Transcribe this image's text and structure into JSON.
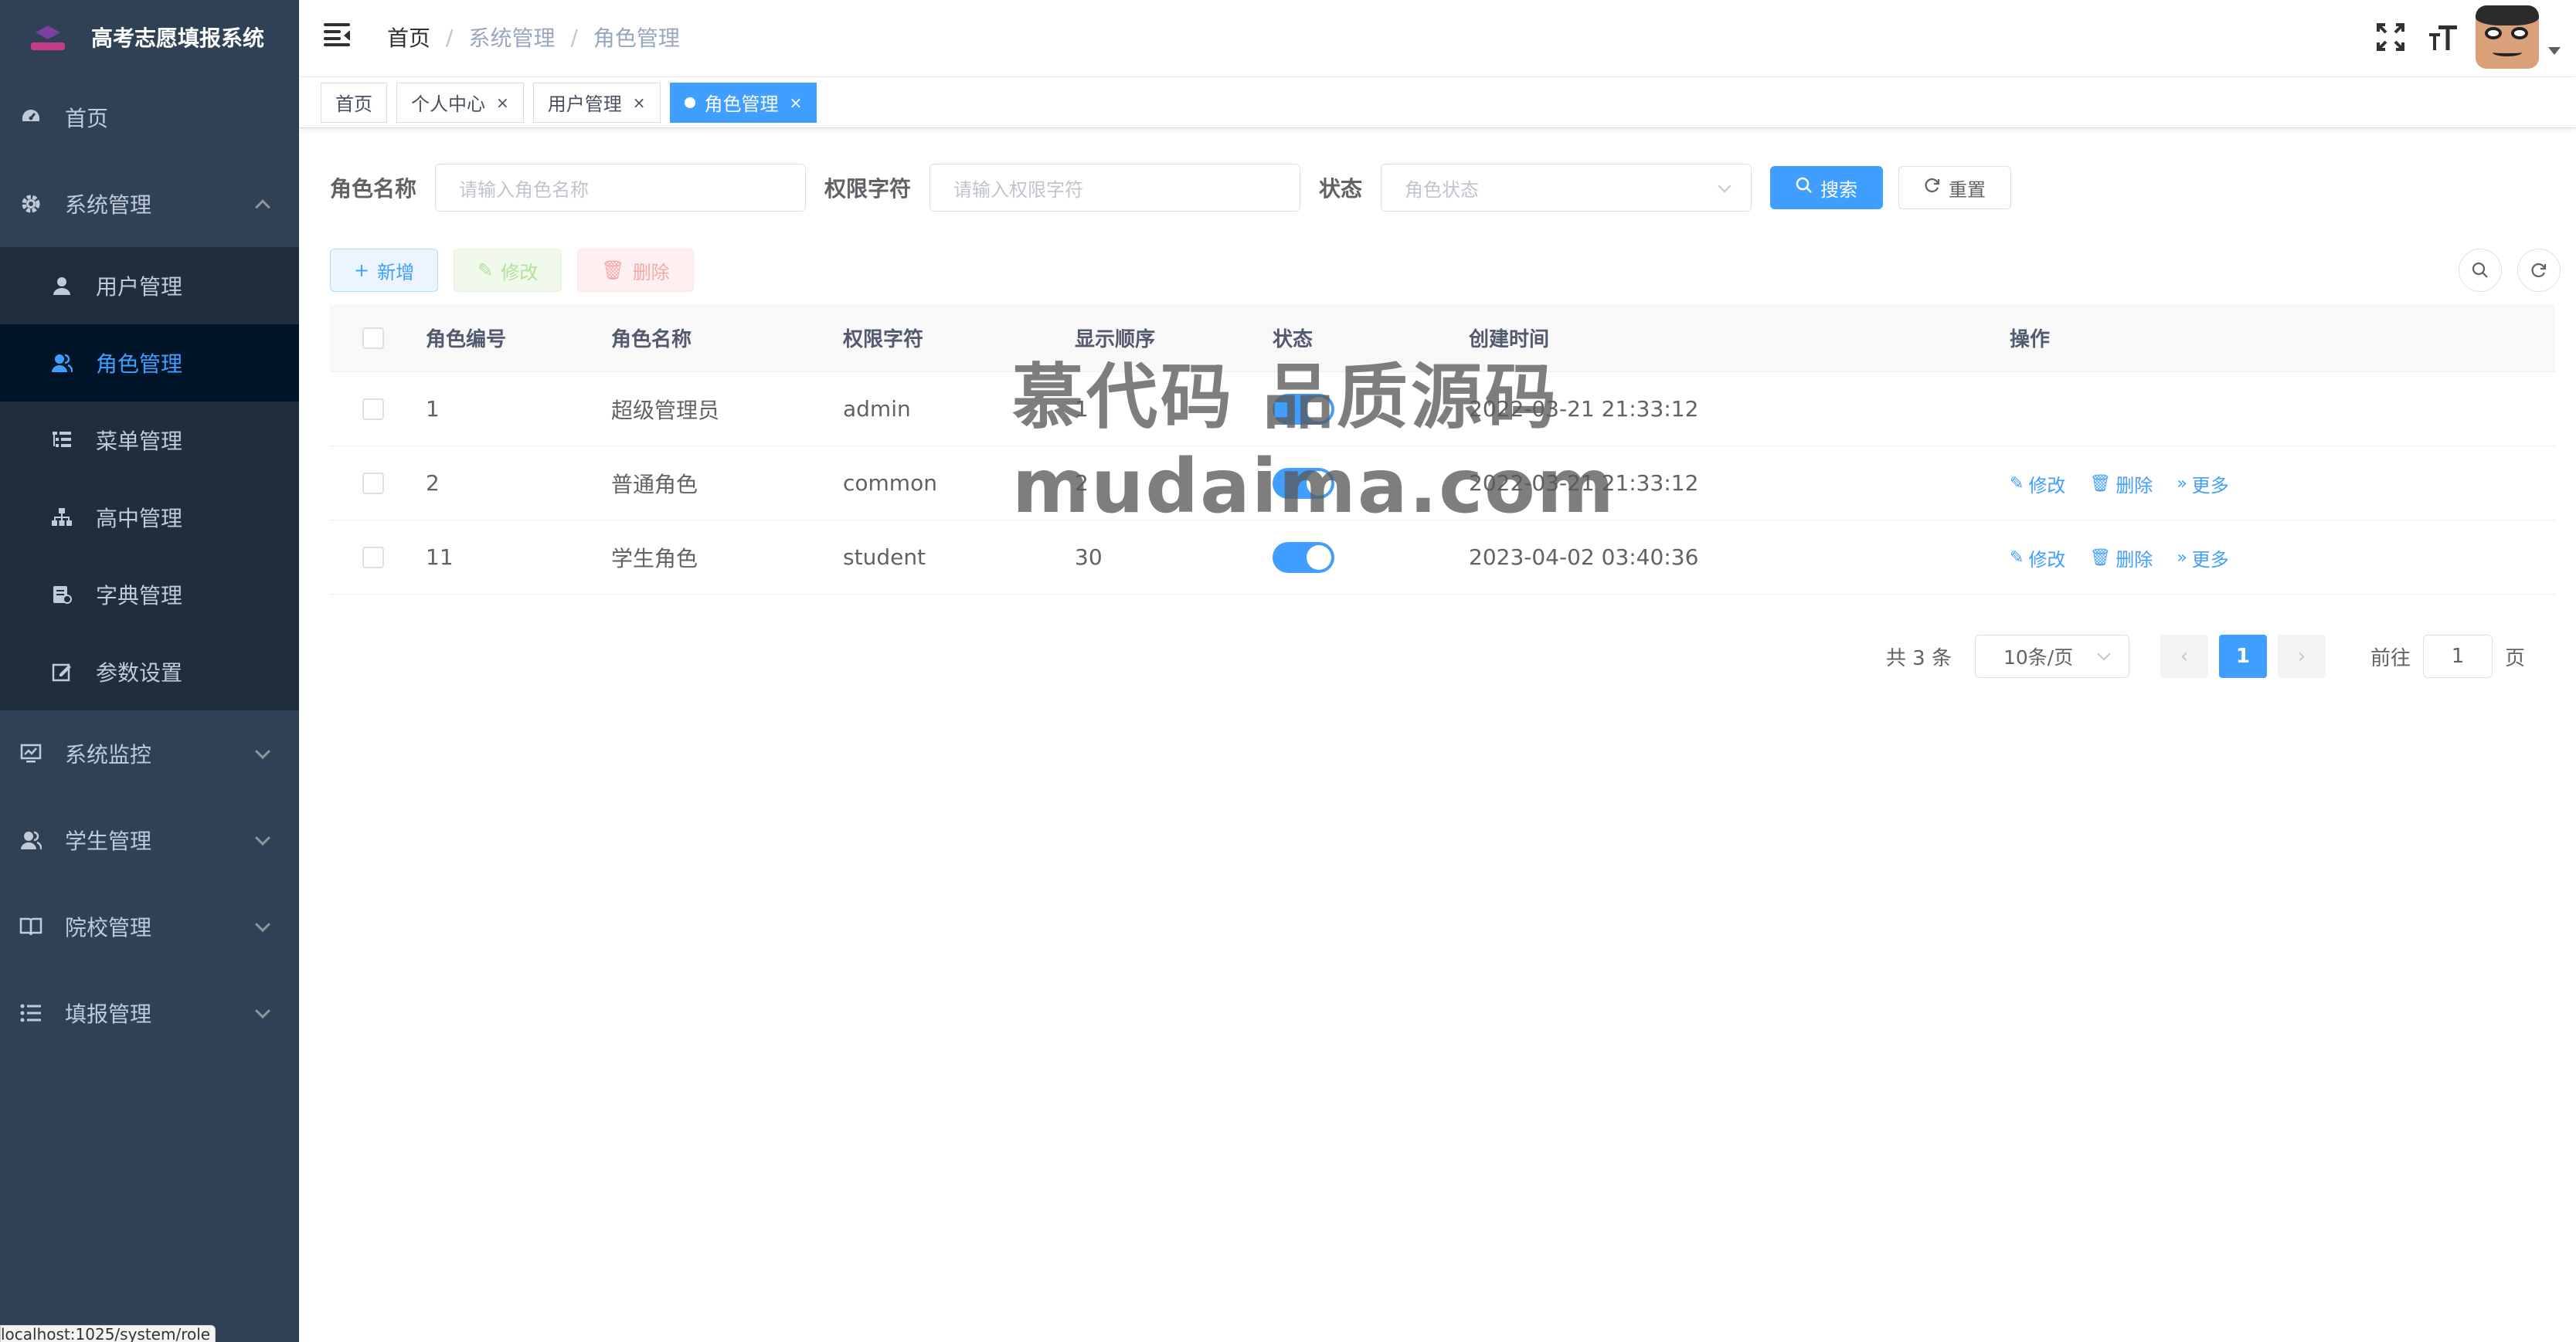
{
  "app": {
    "title": "高考志愿填报系统"
  },
  "sidebar": {
    "items": [
      {
        "label": "首页",
        "icon": "dashboard-icon"
      },
      {
        "label": "系统管理",
        "icon": "gear-icon",
        "expanded": true,
        "children": [
          {
            "label": "用户管理",
            "icon": "user-icon"
          },
          {
            "label": "角色管理",
            "icon": "peoples-icon",
            "active": true
          },
          {
            "label": "菜单管理",
            "icon": "tree-table-icon"
          },
          {
            "label": "高中管理",
            "icon": "tree-icon"
          },
          {
            "label": "字典管理",
            "icon": "dict-icon"
          },
          {
            "label": "参数设置",
            "icon": "edit-icon"
          }
        ]
      },
      {
        "label": "系统监控",
        "icon": "monitor-icon"
      },
      {
        "label": "学生管理",
        "icon": "student-icon"
      },
      {
        "label": "院校管理",
        "icon": "book-icon"
      },
      {
        "label": "填报管理",
        "icon": "list-icon"
      }
    ]
  },
  "status_url": "localhost:1025/system/role",
  "navbar": {
    "breadcrumb": [
      "首页",
      "系统管理",
      "角色管理"
    ],
    "icons": [
      "fullscreen-icon",
      "font-size-icon"
    ],
    "avatar": "user-avatar"
  },
  "tags": [
    {
      "label": "首页",
      "closable": false
    },
    {
      "label": "个人中心",
      "closable": true
    },
    {
      "label": "用户管理",
      "closable": true
    },
    {
      "label": "角色管理",
      "closable": true,
      "active": true
    }
  ],
  "search": {
    "role_name_label": "角色名称",
    "role_name_placeholder": "请输入角色名称",
    "role_key_label": "权限字符",
    "role_key_placeholder": "请输入权限字符",
    "status_label": "状态",
    "status_placeholder": "角色状态",
    "search_btn": "搜索",
    "reset_btn": "重置"
  },
  "toolbar": {
    "add": "新增",
    "edit": "修改",
    "delete": "删除"
  },
  "table": {
    "headers": [
      "角色编号",
      "角色名称",
      "权限字符",
      "显示顺序",
      "状态",
      "创建时间",
      "操作"
    ],
    "rows": [
      {
        "id": "1",
        "name": "超级管理员",
        "key": "admin",
        "sort": "1",
        "status": true,
        "time": "2022-03-21 21:33:12",
        "ops": false
      },
      {
        "id": "2",
        "name": "普通角色",
        "key": "common",
        "sort": "2",
        "status": true,
        "time": "2022-03-21 21:33:12",
        "ops": true
      },
      {
        "id": "11",
        "name": "学生角色",
        "key": "student",
        "sort": "30",
        "status": true,
        "time": "2023-04-02 03:40:36",
        "ops": true
      }
    ],
    "op_labels": {
      "edit": "修改",
      "delete": "删除",
      "more": "更多"
    }
  },
  "pagination": {
    "total": "共 3 条",
    "page_size": "10条/页",
    "current_page": "1",
    "goto_label": "前往",
    "goto_value": "1",
    "page_suffix": "页"
  },
  "watermark": {
    "line1": "慕代码 品质源码",
    "line2": "mudaima.com"
  },
  "colors": {
    "sidebar_bg": "#304156",
    "submenu_bg": "#1f2d3d",
    "primary": "#409eff"
  }
}
